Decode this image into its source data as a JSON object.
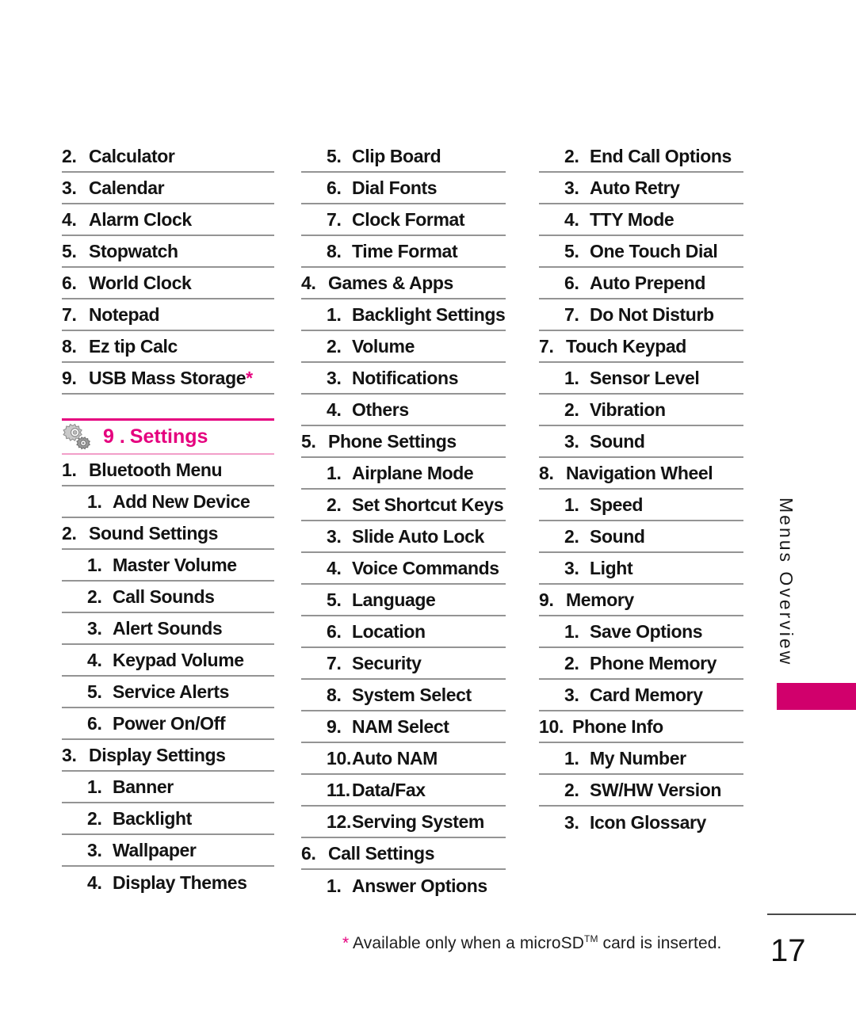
{
  "page": {
    "number": "17",
    "side_label": "Menus Overview",
    "footnote_star": "*",
    "footnote_text_before": " Available only when a microSD",
    "footnote_tm": "TM",
    "footnote_text_after": " card is inserted."
  },
  "colors": {
    "accent": "#E5007E",
    "tab": "#D1006C",
    "rule": "#949494",
    "text": "#131313"
  },
  "section": {
    "icon": "gears-icon",
    "number": "9 .",
    "title": "Settings"
  },
  "columns": [
    {
      "id": "column-1",
      "rows": [
        {
          "level": 1,
          "num": "2.",
          "label": "Calculator"
        },
        {
          "level": 1,
          "num": "3.",
          "label": "Calendar"
        },
        {
          "level": 1,
          "num": "4.",
          "label": "Alarm Clock"
        },
        {
          "level": 1,
          "num": "5.",
          "label": "Stopwatch"
        },
        {
          "level": 1,
          "num": "6.",
          "label": "World Clock"
        },
        {
          "level": 1,
          "num": "7.",
          "label": "Notepad"
        },
        {
          "level": 1,
          "num": "8.",
          "label": "Ez tip Calc"
        },
        {
          "level": 1,
          "num": "9.",
          "label": "USB Mass Storage",
          "star": "*"
        }
      ],
      "after_section_rows": [
        {
          "level": 1,
          "num": "1.",
          "label": "Bluetooth Menu"
        },
        {
          "level": 2,
          "num": "1.",
          "label": "Add New Device"
        },
        {
          "level": 1,
          "num": "2.",
          "label": "Sound Settings"
        },
        {
          "level": 2,
          "num": "1.",
          "label": "Master Volume"
        },
        {
          "level": 2,
          "num": "2.",
          "label": "Call Sounds"
        },
        {
          "level": 2,
          "num": "3.",
          "label": "Alert Sounds"
        },
        {
          "level": 2,
          "num": "4.",
          "label": "Keypad Volume"
        },
        {
          "level": 2,
          "num": "5.",
          "label": "Service Alerts"
        },
        {
          "level": 2,
          "num": "6.",
          "label": "Power On/Off"
        },
        {
          "level": 1,
          "num": "3.",
          "label": "Display Settings"
        },
        {
          "level": 2,
          "num": "1.",
          "label": "Banner"
        },
        {
          "level": 2,
          "num": "2.",
          "label": "Backlight"
        },
        {
          "level": 2,
          "num": "3.",
          "label": "Wallpaper"
        },
        {
          "level": 2,
          "num": "4.",
          "label": "Display Themes",
          "last": true
        }
      ]
    },
    {
      "id": "column-2",
      "rows": [
        {
          "level": 2,
          "num": "5.",
          "label": "Clip Board"
        },
        {
          "level": 2,
          "num": "6.",
          "label": "Dial Fonts"
        },
        {
          "level": 2,
          "num": "7.",
          "label": "Clock Format"
        },
        {
          "level": 2,
          "num": "8.",
          "label": "Time Format"
        },
        {
          "level": 1,
          "num": "4.",
          "label": "Games & Apps"
        },
        {
          "level": 2,
          "num": "1.",
          "label": "Backlight Settings"
        },
        {
          "level": 2,
          "num": "2.",
          "label": "Volume"
        },
        {
          "level": 2,
          "num": "3.",
          "label": "Notifications"
        },
        {
          "level": 2,
          "num": "4.",
          "label": "Others"
        },
        {
          "level": 1,
          "num": "5.",
          "label": "Phone Settings"
        },
        {
          "level": 2,
          "num": "1.",
          "label": "Airplane Mode"
        },
        {
          "level": 2,
          "num": "2.",
          "label": "Set Shortcut Keys"
        },
        {
          "level": 2,
          "num": "3.",
          "label": "Slide Auto Lock"
        },
        {
          "level": 2,
          "num": "4.",
          "label": "Voice Commands"
        },
        {
          "level": 2,
          "num": "5.",
          "label": "Language"
        },
        {
          "level": 2,
          "num": "6.",
          "label": "Location"
        },
        {
          "level": 2,
          "num": "7.",
          "label": "Security"
        },
        {
          "level": 2,
          "num": "8.",
          "label": "System Select"
        },
        {
          "level": 2,
          "num": "9.",
          "label": "NAM Select"
        },
        {
          "level": 2,
          "num": "10.",
          "label": "Auto NAM",
          "wide": true
        },
        {
          "level": 2,
          "num": "11.",
          "label": "Data/Fax",
          "wide": true
        },
        {
          "level": 2,
          "num": "12.",
          "label": "Serving System",
          "wide": true
        },
        {
          "level": 1,
          "num": "6.",
          "label": "Call Settings"
        },
        {
          "level": 2,
          "num": "1.",
          "label": "Answer Options",
          "last": true
        }
      ]
    },
    {
      "id": "column-3",
      "rows": [
        {
          "level": 2,
          "num": "2.",
          "label": "End Call Options"
        },
        {
          "level": 2,
          "num": "3.",
          "label": "Auto Retry"
        },
        {
          "level": 2,
          "num": "4.",
          "label": "TTY Mode"
        },
        {
          "level": 2,
          "num": "5.",
          "label": "One Touch Dial"
        },
        {
          "level": 2,
          "num": "6.",
          "label": "Auto Prepend"
        },
        {
          "level": 2,
          "num": "7.",
          "label": "Do Not Disturb"
        },
        {
          "level": 1,
          "num": "7.",
          "label": "Touch Keypad"
        },
        {
          "level": 2,
          "num": "1.",
          "label": "Sensor Level"
        },
        {
          "level": 2,
          "num": "2.",
          "label": "Vibration"
        },
        {
          "level": 2,
          "num": "3.",
          "label": "Sound"
        },
        {
          "level": 1,
          "num": "8.",
          "label": "Navigation Wheel"
        },
        {
          "level": 2,
          "num": "1.",
          "label": "Speed"
        },
        {
          "level": 2,
          "num": "2.",
          "label": "Sound"
        },
        {
          "level": 2,
          "num": "3.",
          "label": "Light"
        },
        {
          "level": 1,
          "num": "9.",
          "label": "Memory"
        },
        {
          "level": 2,
          "num": "1.",
          "label": "Save Options"
        },
        {
          "level": 2,
          "num": "2.",
          "label": "Phone Memory"
        },
        {
          "level": 2,
          "num": "3.",
          "label": "Card Memory"
        },
        {
          "level": 1,
          "num": "10.",
          "label": "Phone Info",
          "wide": true
        },
        {
          "level": 2,
          "num": "1.",
          "label": "My Number"
        },
        {
          "level": 2,
          "num": "2.",
          "label": "SW/HW Version"
        },
        {
          "level": 2,
          "num": "3.",
          "label": "Icon Glossary",
          "last": true
        }
      ]
    }
  ]
}
